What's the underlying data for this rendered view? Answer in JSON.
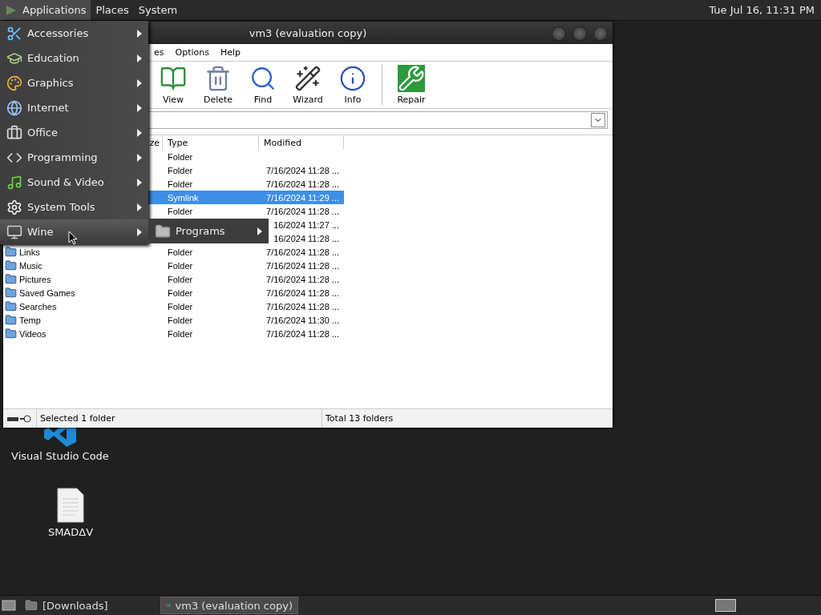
{
  "top_panel": {
    "menus": [
      {
        "label": "Applications",
        "selected": true
      },
      {
        "label": "Places",
        "selected": false
      },
      {
        "label": "System",
        "selected": false
      }
    ],
    "clock": "Tue Jul 16, 11:31 PM"
  },
  "applications_menu": {
    "items": [
      {
        "label": "Accessories",
        "kind": "accessories",
        "selected": false
      },
      {
        "label": "Education",
        "kind": "education",
        "selected": false
      },
      {
        "label": "Graphics",
        "kind": "graphics",
        "selected": false
      },
      {
        "label": "Internet",
        "kind": "internet",
        "selected": false
      },
      {
        "label": "Office",
        "kind": "office",
        "selected": false
      },
      {
        "label": "Programming",
        "kind": "programming",
        "selected": false
      },
      {
        "label": "Sound & Video",
        "kind": "sound",
        "selected": false
      },
      {
        "label": "System Tools",
        "kind": "system",
        "selected": false
      },
      {
        "label": "Wine",
        "kind": "wine",
        "selected": true
      }
    ]
  },
  "submenu": {
    "items": [
      {
        "label": "Programs"
      }
    ]
  },
  "window": {
    "title": "vm3 (evaluation copy)",
    "menu_bar": [
      "es",
      "Options",
      "Help"
    ],
    "toolbar": [
      {
        "label": "View",
        "kind": "view"
      },
      {
        "label": "Delete",
        "kind": "delete"
      },
      {
        "label": "Find",
        "kind": "find"
      },
      {
        "label": "Wizard",
        "kind": "wizard"
      },
      {
        "label": "Info",
        "kind": "info"
      },
      {
        "label": "Repair",
        "kind": "repair",
        "separated": true
      }
    ],
    "columns": [
      "ze",
      "Type",
      "Modified"
    ],
    "rows": [
      {
        "type": "Folder",
        "selected": false
      },
      {
        "type": "Folder",
        "modified": "7/16/2024 11:28 ...",
        "selected": false
      },
      {
        "type": "Folder",
        "modified": "7/16/2024 11:28 ...",
        "selected": false
      },
      {
        "type": "Symlink",
        "modified": "7/16/2024 11:29 ...",
        "selected": true
      },
      {
        "type": "Folder",
        "modified": "7/16/2024 11:28 ...",
        "selected": false
      },
      {
        "modified": "16/2024 11:27 ...",
        "selected": false
      },
      {
        "modified": "16/2024 11:28 ...",
        "selected": false
      },
      {
        "name": "Links",
        "type": "Folder",
        "modified": "7/16/2024 11:28 ...",
        "selected": false
      },
      {
        "name": "Music",
        "type": "Folder",
        "modified": "7/16/2024 11:28 ...",
        "selected": false
      },
      {
        "name": "Pictures",
        "type": "Folder",
        "modified": "7/16/2024 11:28 ...",
        "selected": false
      },
      {
        "name": "Saved Games",
        "type": "Folder",
        "modified": "7/16/2024 11:28 ...",
        "selected": false
      },
      {
        "name": "Searches",
        "type": "Folder",
        "modified": "7/16/2024 11:28 ...",
        "selected": false
      },
      {
        "name": "Temp",
        "type": "Folder",
        "modified": "7/16/2024 11:30 ...",
        "selected": false
      },
      {
        "name": "Videos",
        "type": "Folder",
        "modified": "7/16/2024 11:28 ...",
        "selected": false
      }
    ],
    "status_left": "Selected 1 folder",
    "status_right": "Total 13 folders"
  },
  "desktop_icons": [
    {
      "label": "Visual Studio Code",
      "kind": "code"
    },
    {
      "label": "SMADΔV",
      "kind": "file"
    }
  ],
  "taskbar": {
    "items": [
      {
        "label": "[Downloads]",
        "kind": "folder",
        "selected": false
      },
      {
        "label": "vm3 (evaluation copy)",
        "kind": "archive",
        "selected": true
      }
    ]
  }
}
